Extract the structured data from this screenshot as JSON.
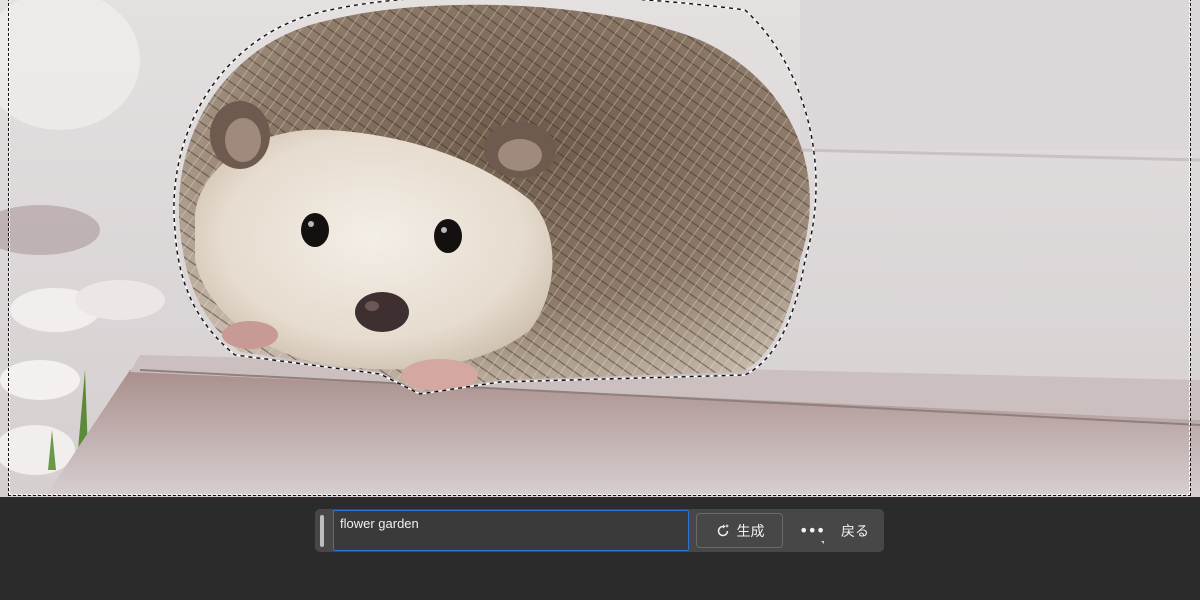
{
  "canvas": {
    "subject": "hedgehog photo with active selection"
  },
  "taskbar": {
    "prompt_value": "flower garden",
    "generate_label": "生成",
    "more_label": "•••",
    "back_label": "戻る"
  },
  "icons": {
    "generate": "refresh-sparkle-icon",
    "more": "more-options-icon",
    "grip": "drag-handle-icon"
  },
  "colors": {
    "taskbar_bg": "#474747",
    "prompt_border": "#2f73d6",
    "app_bg": "#2b2b2b"
  }
}
